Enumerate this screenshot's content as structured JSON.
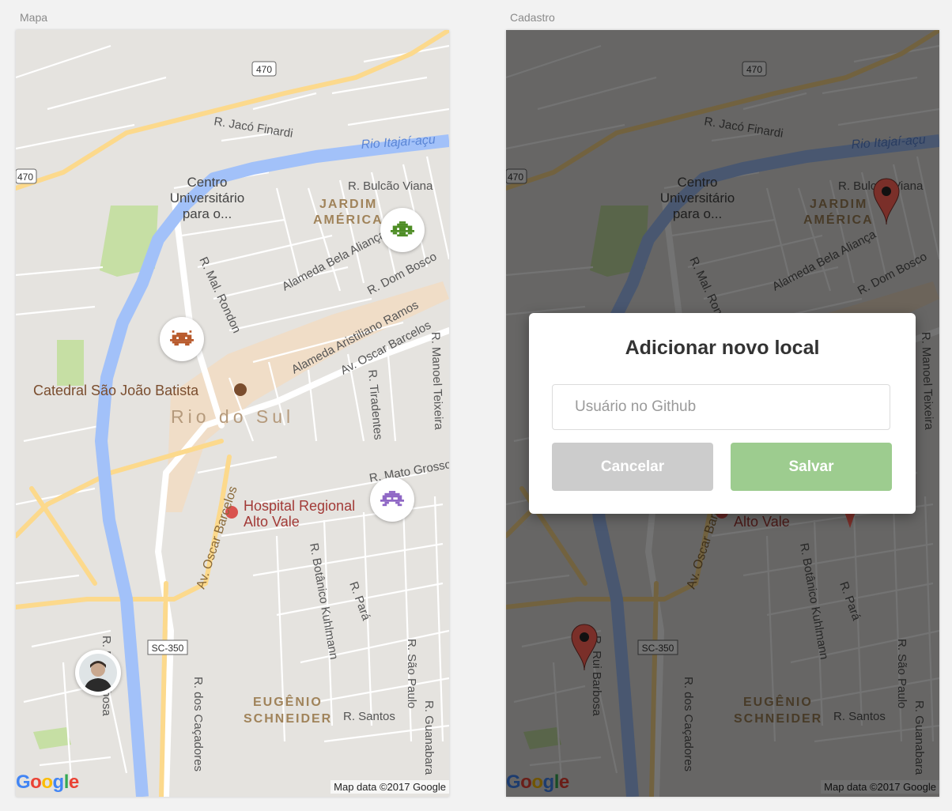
{
  "screens": [
    {
      "label": "Mapa"
    },
    {
      "label": "Cadastro"
    }
  ],
  "map": {
    "labels": {
      "route_470": "470",
      "route_sc350": "SC-350",
      "jaco": "R. Jacó Finardi",
      "rio_itajai": "Rio Itajaí-açu",
      "centro1": "Centro",
      "centro2": "Universitário",
      "centro3": "para o...",
      "bulcao": "R. Bulcão Viana",
      "jardim": "JARDIM",
      "america": "AMÉRICA",
      "bela_alianca": "Alameda Bela Aliança",
      "dom_bosco": "R. Dom Bosco",
      "mal_rondon": "R. Mal. Rondon",
      "aristiliano": "Alameda Aristiliano Ramos",
      "oscar1": "Av. Oscar Barcelos",
      "manoel": "R. Manoel Teixeira",
      "catedral": "Catedral São João Batista",
      "rio_do_sul": "Rio do Sul",
      "tiradentes": "R. Tiradentes",
      "mato_grosso": "R. Mato Grosso",
      "hospital1": "Hospital Regional",
      "hospital2": "Alto Vale",
      "oscar2": "Av. Oscar Barcelos",
      "botanico": "R. Botânico Kuhlmann",
      "para": "R. Pará",
      "rui_barbosa": "R. Rui Barbosa",
      "sao_paulo": "R. São Paulo",
      "eugenio": "EUGÊNIO",
      "schneider": "SCHNEIDER",
      "santos": "R. Santos",
      "cacadores": "R. dos Caçadores",
      "guanabara": "R. Guanabara"
    },
    "google_logo": "Google",
    "attribution": "Map data ©2017 Google",
    "colors": {
      "background": "#e5e3df",
      "road": "#ffffff",
      "highway": "#fcd98c",
      "river": "#a2c1f9",
      "park": "#c6dfa4"
    }
  },
  "markers": {
    "green_invader": {
      "icon": "green-space-invader-icon",
      "color": "#4e8d25"
    },
    "brown_invader": {
      "icon": "brown-space-invader-icon",
      "color": "#b85a2c"
    },
    "purple_invader": {
      "icon": "purple-space-invader-icon",
      "color": "#8f67c5"
    },
    "user_avatar": {
      "icon": "user-avatar-photo"
    },
    "pin": {
      "icon": "map-pin-icon",
      "color": "#8e3129"
    }
  },
  "modal": {
    "title": "Adicionar novo local",
    "input_placeholder": "Usuário no Github",
    "input_value": "",
    "cancel_label": "Cancelar",
    "save_label": "Salvar",
    "cancel_color": "#cccccc",
    "save_color": "#9dcc8f"
  }
}
